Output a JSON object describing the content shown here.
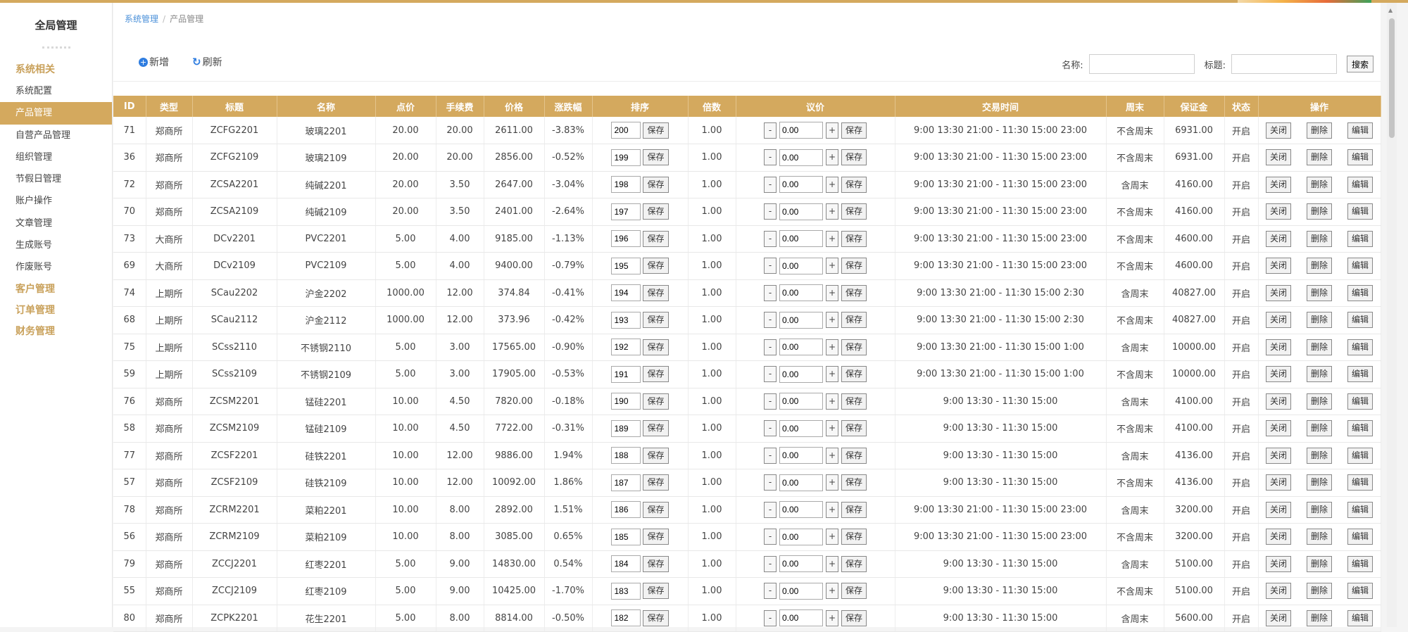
{
  "sidebar": {
    "title": "全局管理",
    "groups": [
      {
        "label": "系统相关",
        "items": [
          "系统配置",
          "产品管理",
          "自营产品管理",
          "组织管理",
          "节假日管理",
          "账户操作",
          "文章管理",
          "生成账号",
          "作废账号"
        ]
      },
      {
        "label": "客户管理",
        "items": []
      },
      {
        "label": "订单管理",
        "items": []
      },
      {
        "label": "财务管理",
        "items": []
      }
    ],
    "active_item": "产品管理"
  },
  "breadcrumb": {
    "root": "系统管理",
    "current": "产品管理"
  },
  "toolbar": {
    "add_label": "新增",
    "refresh_label": "刷新",
    "name_label": "名称:",
    "title_label": "标题:",
    "search_label": "搜索"
  },
  "table": {
    "columns": [
      "ID",
      "类型",
      "标题",
      "名称",
      "点价",
      "手续费",
      "价格",
      "涨跌幅",
      "排序",
      "倍数",
      "议价",
      "交易时间",
      "周末",
      "保证金",
      "状态",
      "操作"
    ],
    "save_label": "保存",
    "minus_label": "-",
    "plus_label": "+",
    "close_label": "关闭",
    "delete_label": "删除",
    "edit_label": "编辑",
    "rows": [
      [
        "71",
        "郑商所",
        "ZCFG2201",
        "玻璃2201",
        "20.00",
        "20.00",
        "2611.00",
        "-3.83%",
        "200",
        "1.00",
        "0.00",
        "9:00 13:30 21:00 - 11:30 15:00 23:00",
        "不含周末",
        "6931.00",
        "开启"
      ],
      [
        "36",
        "郑商所",
        "ZCFG2109",
        "玻璃2109",
        "20.00",
        "20.00",
        "2856.00",
        "-0.52%",
        "199",
        "1.00",
        "0.00",
        "9:00 13:30 21:00 - 11:30 15:00 23:00",
        "不含周末",
        "6931.00",
        "开启"
      ],
      [
        "72",
        "郑商所",
        "ZCSA2201",
        "纯碱2201",
        "20.00",
        "3.50",
        "2647.00",
        "-3.04%",
        "198",
        "1.00",
        "0.00",
        "9:00 13:30 21:00 - 11:30 15:00 23:00",
        "含周末",
        "4160.00",
        "开启"
      ],
      [
        "70",
        "郑商所",
        "ZCSA2109",
        "纯碱2109",
        "20.00",
        "3.50",
        "2401.00",
        "-2.64%",
        "197",
        "1.00",
        "0.00",
        "9:00 13:30 21:00 - 11:30 15:00 23:00",
        "不含周末",
        "4160.00",
        "开启"
      ],
      [
        "73",
        "大商所",
        "DCv2201",
        "PVC2201",
        "5.00",
        "4.00",
        "9185.00",
        "-1.13%",
        "196",
        "1.00",
        "0.00",
        "9:00 13:30 21:00 - 11:30 15:00 23:00",
        "不含周末",
        "4600.00",
        "开启"
      ],
      [
        "69",
        "大商所",
        "DCv2109",
        "PVC2109",
        "5.00",
        "4.00",
        "9400.00",
        "-0.79%",
        "195",
        "1.00",
        "0.00",
        "9:00 13:30 21:00 - 11:30 15:00 23:00",
        "不含周末",
        "4600.00",
        "开启"
      ],
      [
        "74",
        "上期所",
        "SCau2202",
        "沪金2202",
        "1000.00",
        "12.00",
        "374.84",
        "-0.41%",
        "194",
        "1.00",
        "0.00",
        "9:00 13:30 21:00 - 11:30 15:00 2:30",
        "含周末",
        "40827.00",
        "开启"
      ],
      [
        "68",
        "上期所",
        "SCau2112",
        "沪金2112",
        "1000.00",
        "12.00",
        "373.96",
        "-0.42%",
        "193",
        "1.00",
        "0.00",
        "9:00 13:30 21:00 - 11:30 15:00 2:30",
        "不含周末",
        "40827.00",
        "开启"
      ],
      [
        "75",
        "上期所",
        "SCss2110",
        "不锈钢2110",
        "5.00",
        "3.00",
        "17565.00",
        "-0.90%",
        "192",
        "1.00",
        "0.00",
        "9:00 13:30 21:00 - 11:30 15:00 1:00",
        "含周末",
        "10000.00",
        "开启"
      ],
      [
        "59",
        "上期所",
        "SCss2109",
        "不锈钢2109",
        "5.00",
        "3.00",
        "17905.00",
        "-0.53%",
        "191",
        "1.00",
        "0.00",
        "9:00 13:30 21:00 - 11:30 15:00 1:00",
        "不含周末",
        "10000.00",
        "开启"
      ],
      [
        "76",
        "郑商所",
        "ZCSM2201",
        "锰硅2201",
        "10.00",
        "4.50",
        "7820.00",
        "-0.18%",
        "190",
        "1.00",
        "0.00",
        "9:00 13:30 - 11:30 15:00",
        "含周末",
        "4100.00",
        "开启"
      ],
      [
        "58",
        "郑商所",
        "ZCSM2109",
        "锰硅2109",
        "10.00",
        "4.50",
        "7722.00",
        "-0.31%",
        "189",
        "1.00",
        "0.00",
        "9:00 13:30 - 11:30 15:00",
        "不含周末",
        "4100.00",
        "开启"
      ],
      [
        "77",
        "郑商所",
        "ZCSF2201",
        "硅铁2201",
        "10.00",
        "12.00",
        "9886.00",
        "1.94%",
        "188",
        "1.00",
        "0.00",
        "9:00 13:30 - 11:30 15:00",
        "含周末",
        "4136.00",
        "开启"
      ],
      [
        "57",
        "郑商所",
        "ZCSF2109",
        "硅铁2109",
        "10.00",
        "12.00",
        "10092.00",
        "1.86%",
        "187",
        "1.00",
        "0.00",
        "9:00 13:30 - 11:30 15:00",
        "不含周末",
        "4136.00",
        "开启"
      ],
      [
        "78",
        "郑商所",
        "ZCRM2201",
        "菜粕2201",
        "10.00",
        "8.00",
        "2892.00",
        "1.51%",
        "186",
        "1.00",
        "0.00",
        "9:00 13:30 21:00 - 11:30 15:00 23:00",
        "含周末",
        "3200.00",
        "开启"
      ],
      [
        "56",
        "郑商所",
        "ZCRM2109",
        "菜粕2109",
        "10.00",
        "8.00",
        "3085.00",
        "0.65%",
        "185",
        "1.00",
        "0.00",
        "9:00 13:30 21:00 - 11:30 15:00 23:00",
        "不含周末",
        "3200.00",
        "开启"
      ],
      [
        "79",
        "郑商所",
        "ZCCJ2201",
        "红枣2201",
        "5.00",
        "9.00",
        "14830.00",
        "0.54%",
        "184",
        "1.00",
        "0.00",
        "9:00 13:30 - 11:30 15:00",
        "含周末",
        "5100.00",
        "开启"
      ],
      [
        "55",
        "郑商所",
        "ZCCJ2109",
        "红枣2109",
        "5.00",
        "9.00",
        "10425.00",
        "-1.70%",
        "183",
        "1.00",
        "0.00",
        "9:00 13:30 - 11:30 15:00",
        "不含周末",
        "5100.00",
        "开启"
      ],
      [
        "80",
        "郑商所",
        "ZCPK2201",
        "花生2201",
        "5.00",
        "8.00",
        "8814.00",
        "-0.50%",
        "182",
        "1.00",
        "0.00",
        "9:00 13:30 - 11:30 15:00",
        "含周末",
        "5600.00",
        "开启"
      ]
    ]
  },
  "colors": {
    "accent": "#d4a95e",
    "link": "#4a90d9",
    "status_open": "#e64040"
  }
}
